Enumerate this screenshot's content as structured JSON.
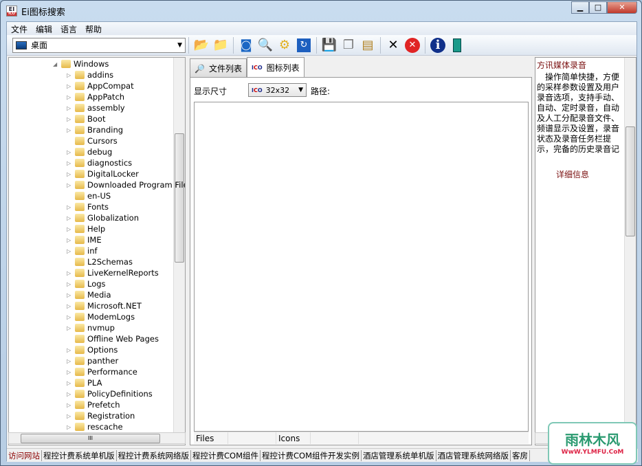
{
  "window": {
    "title": "Ei图标搜索",
    "logo_text": "EI",
    "logo_sub": "ICO",
    "controls": [
      "▁",
      "□",
      "✕"
    ]
  },
  "menu": [
    "文件",
    "编辑",
    "语言",
    "帮助"
  ],
  "toolbar": {
    "location": "桌面",
    "icons": [
      "open-folder-icon",
      "folder-up-icon",
      "stop-icon",
      "search-icon",
      "settings-icon",
      "refresh-icon",
      "save-icon",
      "copy-icon",
      "export-icon",
      "delete-icon",
      "cancel-icon",
      "info-icon",
      "exit-icon"
    ]
  },
  "tree": {
    "parent": "Windows",
    "items": [
      "addins",
      "AppCompat",
      "AppPatch",
      "assembly",
      "Boot",
      "Branding",
      "Cursors",
      "debug",
      "diagnostics",
      "DigitalLocker",
      "Downloaded Program Files",
      "en-US",
      "Fonts",
      "Globalization",
      "Help",
      "IME",
      "inf",
      "L2Schemas",
      "LiveKernelReports",
      "Logs",
      "Media",
      "Microsoft.NET",
      "ModemLogs",
      "nvmup",
      "Offline Web Pages",
      "Options",
      "panther",
      "Performance",
      "PLA",
      "PolicyDefinitions",
      "Prefetch",
      "Registration",
      "rescache"
    ],
    "no_expander": [
      "Cursors",
      "en-US",
      "L2Schemas",
      "Offline Web Pages"
    ]
  },
  "tabs": [
    {
      "label": "文件列表"
    },
    {
      "label": "图标列表",
      "active": true
    }
  ],
  "panel": {
    "size_label": "显示尺寸",
    "size_value": "32x32",
    "path_label": "路径:",
    "columns": [
      "Files",
      "Icons"
    ]
  },
  "ad": {
    "title": "方讯媒体录音",
    "desc": "操作简单快捷，方便的采样参数设置及用户录音选项，支持手动、自动、定时录音，自动及人工分配录音文件、频谱显示及设置，录音状态及录音任务栏提示，完备的历史录音记录。",
    "more": "详细信息"
  },
  "status": [
    "访问网站",
    "程控计费系统单机版",
    "程控计费系统网络版",
    "程控计费COM组件",
    "程控计费COM组件开发实例",
    "酒店管理系统单机版",
    "酒店管理系统网络版",
    "客房"
  ],
  "watermark": {
    "name": "雨林木风",
    "url": "WwW.YLMFU.CoM"
  }
}
